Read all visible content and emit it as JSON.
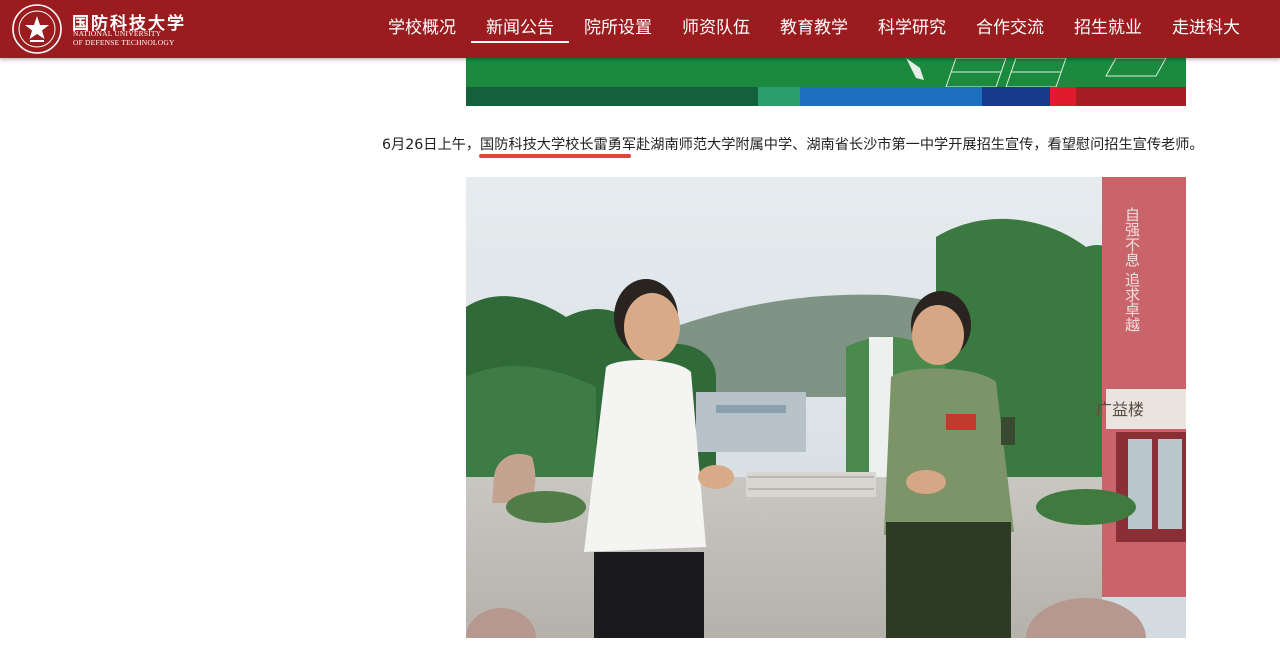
{
  "header": {
    "logo_cn": "国防科技大学",
    "logo_en_line1": "NATIONAL UNIVERSITY",
    "logo_en_line2": "OF DEFENSE TECHNOLOGY",
    "logo_icon": "university-emblem-icon",
    "nav": [
      {
        "label": "学校概况",
        "active": false
      },
      {
        "label": "新闻公告",
        "active": true
      },
      {
        "label": "院所设置",
        "active": false
      },
      {
        "label": "师资队伍",
        "active": false
      },
      {
        "label": "教育教学",
        "active": false
      },
      {
        "label": "科学研究",
        "active": false
      },
      {
        "label": "合作交流",
        "active": false
      },
      {
        "label": "招生就业",
        "active": false
      },
      {
        "label": "走进科大",
        "active": false
      }
    ]
  },
  "article": {
    "caption_prefix": "6月26日上午，",
    "caption_highlight": "国防科技大学校长雷勇军",
    "caption_suffix": "赴湖南师范大学附属中学、湖南省长沙市第一中学开展招生宣传，看望慰问招生宣传老师。",
    "photo_sign_vertical": "自强不息 追求卓越",
    "photo_building_sign": "广益楼"
  },
  "colors": {
    "header_bg": "#9b1c1f",
    "highlight_underline": "#e0443b"
  }
}
